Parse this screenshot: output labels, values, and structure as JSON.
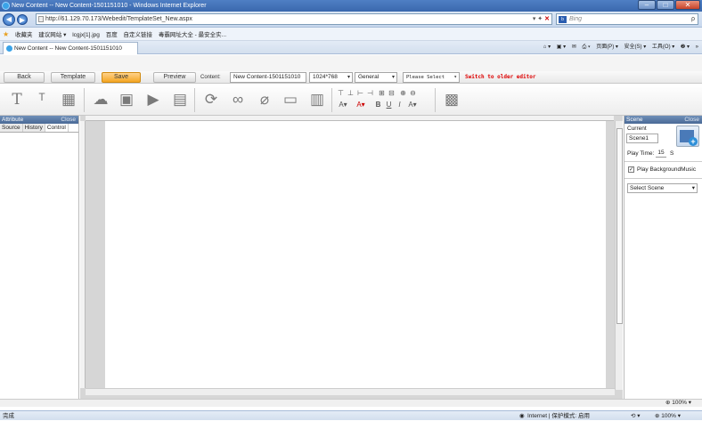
{
  "window": {
    "title": "New Content -- New Content-1501151010 - Windows Internet Explorer",
    "minimize": "–",
    "maximize": "□",
    "close": "✕"
  },
  "browser": {
    "address": "http://61.129.70.173/Webedit/TemplateSet_New.aspx",
    "addr_tools": "▾ ✦ ",
    "addr_close": "✕",
    "search_provider": "b",
    "search_placeholder": "Bing",
    "search_icon": "ρ",
    "favorites": [
      "收藏夹",
      "建议网站 ▾",
      "lcgjx[1].jpg",
      "百度",
      "自定义链接",
      "毒霸网址大全 - 最安全实..."
    ],
    "tab_title": "New Content -- New Content-1501151010",
    "commands": [
      "⌂ ▾",
      "▣ ▾",
      "✉",
      "⎙ ▾",
      "页面(P) ▾",
      "安全(S) ▾",
      "工具(O) ▾",
      "❷ ▾",
      "»"
    ],
    "status_left": "完成",
    "status_zone": "Internet | 保护模式: 启用",
    "status_zoom": "100%",
    "status_icons": "⟲ ▾"
  },
  "toolbar": {
    "back": "Back",
    "template": "Template",
    "save": "Save",
    "preview": "Preview",
    "content_label": "Content:",
    "content_value": "New Content-1501151010",
    "resolution": "1024*768",
    "category": "General",
    "select": "Please Select",
    "switch_link": "Switch to older editor"
  },
  "icons": [
    {
      "name": "text-icon",
      "glyph": "T"
    },
    {
      "name": "text-effect-icon",
      "glyph": "ᵀ"
    },
    {
      "name": "calendar-icon",
      "glyph": "▦"
    },
    {
      "name": "weather-icon",
      "glyph": "☁"
    },
    {
      "name": "image-icon",
      "glyph": "▣"
    },
    {
      "name": "video-icon",
      "glyph": "▶"
    },
    {
      "name": "document-icon",
      "glyph": "▤"
    },
    {
      "name": "rotate-icon",
      "glyph": "⟳"
    },
    {
      "name": "link-icon",
      "glyph": "∞"
    },
    {
      "name": "unlink-icon",
      "glyph": "⌀"
    },
    {
      "name": "frame-icon",
      "glyph": "▭"
    },
    {
      "name": "layout-icon",
      "glyph": "▥"
    },
    {
      "name": "grid-icon",
      "glyph": "▩"
    }
  ],
  "format_tools": {
    "row1": [
      "⊤",
      "⊥",
      "⊢",
      "⊣",
      "⊞",
      "⊟",
      "⊕",
      "⊖"
    ],
    "row2": [
      "A▾",
      "A▾",
      "B",
      "U",
      "I",
      "A▾"
    ]
  },
  "left_panel": {
    "title": "Attribute",
    "close": "Close",
    "tabs": [
      "Source",
      "History",
      "Control"
    ]
  },
  "right_panel": {
    "title": "Scene",
    "close": "Close",
    "current_label": "Current",
    "scene_value": "Scene1",
    "playtime_label": "Play Time:",
    "playtime_value": "15",
    "playtime_unit": "S",
    "bg_music": "Play BackgroundMusic",
    "select_scene": "Select Scene"
  },
  "app_status": {
    "zoom": "100%"
  }
}
